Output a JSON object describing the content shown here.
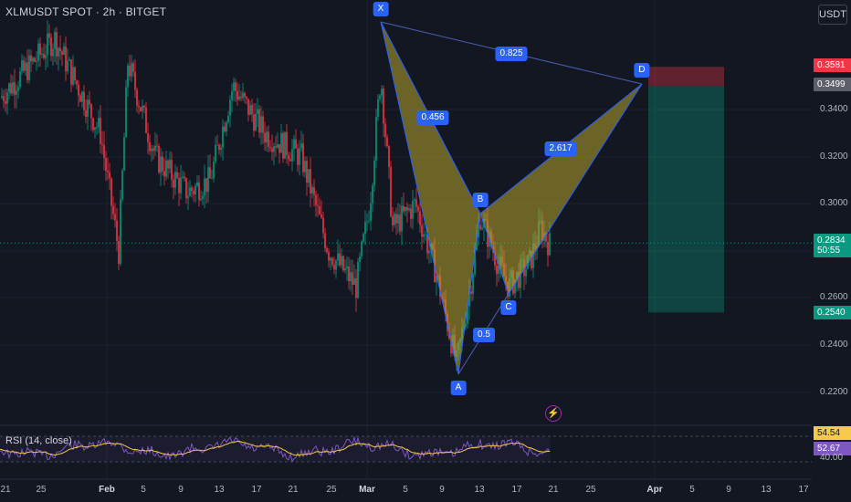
{
  "header": {
    "symbol": "XLMUSDT SPOT · 2h · BITGET"
  },
  "currency_button": "USDT",
  "price_axis": {
    "ticks": [
      "0.3400",
      "0.3200",
      "0.3000",
      "0.2600",
      "0.2400",
      "0.2200"
    ]
  },
  "price_tags": {
    "stop": "0.3581",
    "entry": "0.3499",
    "current": "0.2834",
    "countdown": "50:55",
    "target": "0.2540"
  },
  "time_axis": {
    "ticks": [
      "21",
      "25",
      "Feb",
      "5",
      "9",
      "13",
      "17",
      "21",
      "25",
      "Mar",
      "5",
      "9",
      "13",
      "17",
      "21",
      "25",
      "Apr",
      "5",
      "9",
      "13",
      "17"
    ]
  },
  "pattern": {
    "points": [
      "X",
      "A",
      "B",
      "C",
      "D"
    ],
    "ratios": {
      "xb": "0.456",
      "ac": "0.5",
      "bd": "2.617",
      "xd": "0.825"
    }
  },
  "rsi": {
    "label": "RSI (14, close)",
    "value": "54.54",
    "ma_value": "52.67",
    "ticks": [
      "40.00"
    ]
  },
  "colors": {
    "background": "#131722",
    "up": "#089981",
    "down": "#f23645",
    "accent": "#2962ff",
    "pattern_fill": "#b5a42a",
    "rsi_line": "#7e57c2",
    "rsi_ma": "#f7c948"
  },
  "icons": {
    "alert": "lightning-icon"
  }
}
